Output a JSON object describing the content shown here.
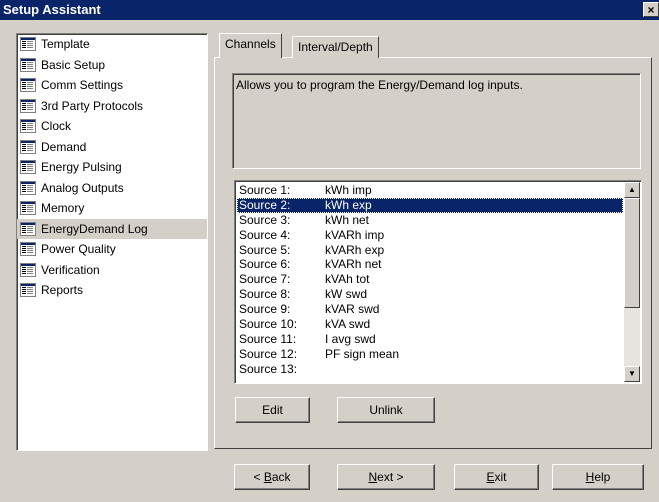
{
  "window": {
    "title": "Setup Assistant",
    "close_glyph": "×"
  },
  "sidebar": {
    "items": [
      {
        "label": "Template"
      },
      {
        "label": "Basic Setup"
      },
      {
        "label": "Comm Settings"
      },
      {
        "label": "3rd Party Protocols"
      },
      {
        "label": "Clock"
      },
      {
        "label": "Demand"
      },
      {
        "label": "Energy Pulsing"
      },
      {
        "label": "Analog Outputs"
      },
      {
        "label": "Memory"
      },
      {
        "label": "EnergyDemand Log"
      },
      {
        "label": "Power Quality"
      },
      {
        "label": "Verification"
      },
      {
        "label": "Reports"
      }
    ],
    "selected_index": 9,
    "icon": "document-icon"
  },
  "tabs": [
    {
      "label": "Channels"
    },
    {
      "label": "Interval/Depth"
    }
  ],
  "description": "Allows you to program the Energy/Demand log inputs.",
  "sources": [
    {
      "label": "Source 1:",
      "value": "kWh imp"
    },
    {
      "label": "Source 2:",
      "value": "kWh exp"
    },
    {
      "label": "Source 3:",
      "value": "kWh net"
    },
    {
      "label": "Source 4:",
      "value": "kVARh imp"
    },
    {
      "label": "Source 5:",
      "value": "kVARh exp"
    },
    {
      "label": "Source 6:",
      "value": "kVARh net"
    },
    {
      "label": "Source 7:",
      "value": "kVAh tot"
    },
    {
      "label": "Source 8:",
      "value": "kW swd"
    },
    {
      "label": "Source 9:",
      "value": "kVAR swd"
    },
    {
      "label": "Source 10:",
      "value": "kVA swd"
    },
    {
      "label": "Source 11:",
      "value": "I avg swd"
    },
    {
      "label": "Source 12:",
      "value": "PF sign mean"
    },
    {
      "label": "Source 13:",
      "value": ""
    }
  ],
  "selected_source_index": 1,
  "buttons": {
    "edit": "Edit",
    "unlink": "Unlink",
    "back": "< Back",
    "next": "Next >",
    "exit": "Exit",
    "help": "Help"
  }
}
